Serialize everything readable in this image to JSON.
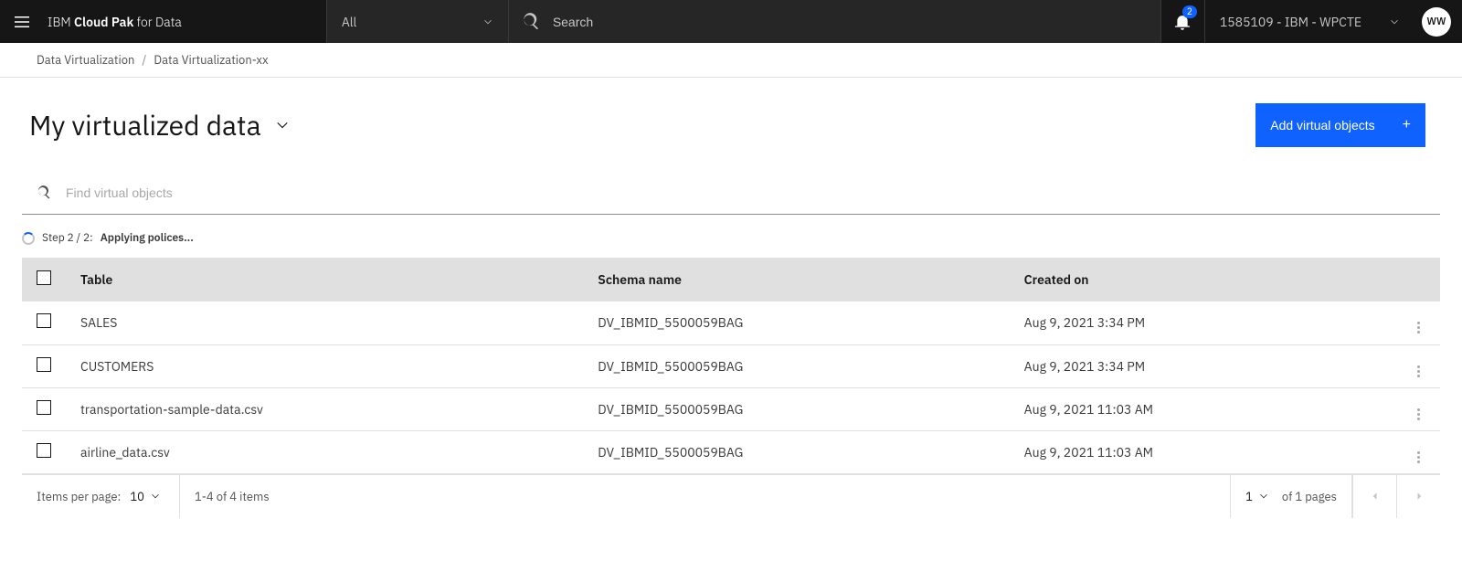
{
  "header": {
    "brand_prefix": "IBM ",
    "brand_bold": "Cloud Pak",
    "brand_suffix": " for Data",
    "filter_label": "All",
    "search_placeholder": "Search",
    "notification_count": "2",
    "account_label": "1585109 - IBM - WPCTE",
    "avatar_initials": "WW"
  },
  "breadcrumb": {
    "items": [
      "Data Virtualization",
      "Data Virtualization-xx"
    ],
    "separator": "/"
  },
  "page": {
    "title": "My virtualized data",
    "add_button": "Add virtual objects"
  },
  "find": {
    "placeholder": "Find virtual objects"
  },
  "status": {
    "step": "Step 2 / 2:",
    "message": "Applying polices..."
  },
  "table": {
    "columns": [
      "Table",
      "Schema name",
      "Created on"
    ],
    "rows": [
      {
        "table": "SALES",
        "schema": "DV_IBMID_5500059BAG",
        "created": "Aug 9, 2021 3:34 PM"
      },
      {
        "table": "CUSTOMERS",
        "schema": "DV_IBMID_5500059BAG",
        "created": "Aug 9, 2021 3:34 PM"
      },
      {
        "table": "transportation-sample-data.csv",
        "schema": "DV_IBMID_5500059BAG",
        "created": "Aug 9, 2021 11:03 AM"
      },
      {
        "table": "airline_data.csv",
        "schema": "DV_IBMID_5500059BAG",
        "created": "Aug 9, 2021 11:03 AM"
      }
    ]
  },
  "pagination": {
    "items_per_page_label": "Items per page:",
    "items_per_page_value": "10",
    "range_text": "1-4 of 4 items",
    "page_value": "1",
    "of_pages": "of 1 pages"
  }
}
